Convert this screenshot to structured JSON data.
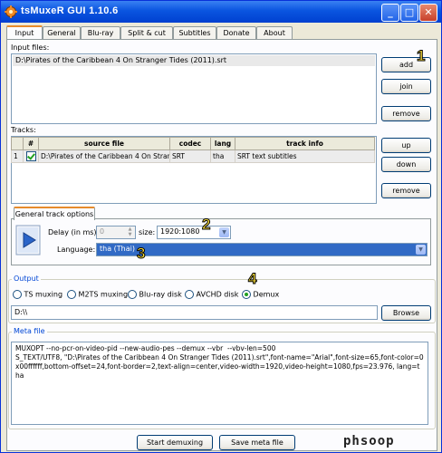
{
  "window": {
    "title": "tsMuxeR GUI 1.10.6",
    "minimize_label": "_",
    "maximize_label": "□",
    "close_label": "✕"
  },
  "tabs": [
    {
      "label": "Input"
    },
    {
      "label": "General"
    },
    {
      "label": "Blu-ray"
    },
    {
      "label": "Split & cut"
    },
    {
      "label": "Subtitles"
    },
    {
      "label": "Donate"
    },
    {
      "label": "About"
    }
  ],
  "input_files": {
    "label": "Input files:",
    "items": [
      "D:\\Pirates of the Caribbean 4 On Stranger Tides (2011).srt"
    ],
    "add_label": "add",
    "join_label": "join",
    "remove_label": "remove"
  },
  "tracks": {
    "label": "Tracks:",
    "columns": [
      "#",
      "source file",
      "codec",
      "lang",
      "track info"
    ],
    "rows": [
      {
        "num": "1",
        "checked": true,
        "source": "D:\\Pirates of the Caribbean 4 On Stran...",
        "codec": "SRT",
        "lang": "tha",
        "info": "SRT text subtitles"
      }
    ],
    "up_label": "up",
    "down_label": "down",
    "remove_label": "remove"
  },
  "track_options": {
    "tab_label": "General track options",
    "delay_label": "Delay (in ms):",
    "delay_value": "0",
    "size_label": "size:",
    "size_value": "1920:1080",
    "language_label": "Language:",
    "language_value": "tha (Thai)"
  },
  "output": {
    "title": "Output",
    "options": [
      {
        "label": "TS muxing",
        "selected": false
      },
      {
        "label": "M2TS muxing",
        "selected": false
      },
      {
        "label": "Blu-ray disk",
        "selected": false
      },
      {
        "label": "AVCHD disk",
        "selected": false
      },
      {
        "label": "Demux",
        "selected": true
      }
    ],
    "path": "D:\\\\",
    "browse_label": "Browse"
  },
  "meta_file": {
    "title": "Meta file",
    "text": "MUXOPT --no-pcr-on-video-pid --new-audio-pes --demux --vbr  --vbv-len=500\nS_TEXT/UTF8, \"D:\\Pirates of the Caribbean 4 On Stranger Tides (2011).srt\",font-name=\"Arial\",font-size=65,font-color=0x00ffffff,bottom-offset=24,font-border=2,text-align=center,video-width=1920,video-height=1080,fps=23.976, lang=tha"
  },
  "actions": {
    "start_label": "Start demuxing",
    "save_label": "Save meta file"
  },
  "annotations": {
    "one": "1",
    "two": "2",
    "three": "3",
    "four": "4"
  },
  "watermark": "phsoop",
  "colors": {
    "title_bar": "#0a55e0",
    "selection": "#316ac5",
    "tab_highlight": "#e68b2c",
    "annotation": "#ffe23a"
  }
}
